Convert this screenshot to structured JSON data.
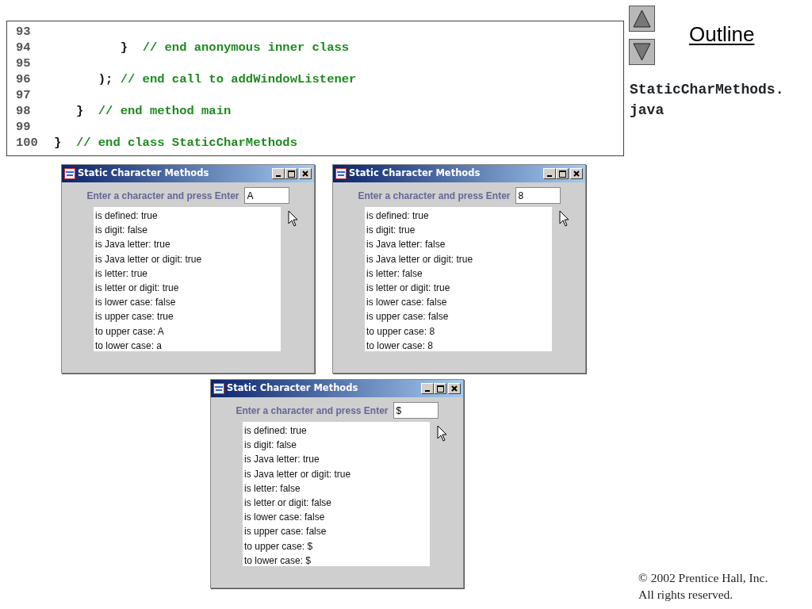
{
  "code_lines": [
    {
      "number": "93"
    },
    {
      "number": "94",
      "code": "         }",
      "comment": "// end anonymous inner class"
    },
    {
      "number": "95"
    },
    {
      "number": "96",
      "code": "      );",
      "comment": "// end call to addWindowListener"
    },
    {
      "number": "97"
    },
    {
      "number": "98",
      "code": "   }",
      "comment": "// end method main"
    },
    {
      "number": "99"
    },
    {
      "number": "100",
      "code": "}",
      "comment": "// end class StaticCharMethods"
    }
  ],
  "windows": [
    {
      "title": "Static Character Methods",
      "prompt": "Enter a character and press Enter",
      "input_value": "A",
      "output_lines": [
        "is defined: true",
        "is digit: false",
        "is Java letter: true",
        "is Java letter or digit: true",
        "is letter: true",
        "is letter or digit: true",
        "is lower case: false",
        "is upper case: true",
        "to upper case: A",
        "to lower case: a"
      ]
    },
    {
      "title": "Static Character Methods",
      "prompt": "Enter a character and press Enter",
      "input_value": "8",
      "output_lines": [
        "is defined: true",
        "is digit: true",
        "is Java letter: false",
        "is Java letter or digit: true",
        "is letter: false",
        "is letter or digit: true",
        "is lower case: false",
        "is upper case: false",
        "to upper case: 8",
        "to lower case: 8"
      ]
    },
    {
      "title": "Static Character Methods",
      "prompt": "Enter a character and press Enter",
      "input_value": "$",
      "output_lines": [
        "is defined: true",
        "is digit: false",
        "is Java letter: true",
        "is Java letter or digit: true",
        "is letter: false",
        "is letter or digit: false",
        "is lower case: false",
        "is upper case: false",
        "to upper case: $",
        "to lower case: $"
      ]
    }
  ],
  "outline": {
    "title": "Outline",
    "file_name": "StaticCharMethods.java"
  },
  "footer": [
    "© 2002 Prentice Hall, Inc.",
    "All rights reserved."
  ]
}
